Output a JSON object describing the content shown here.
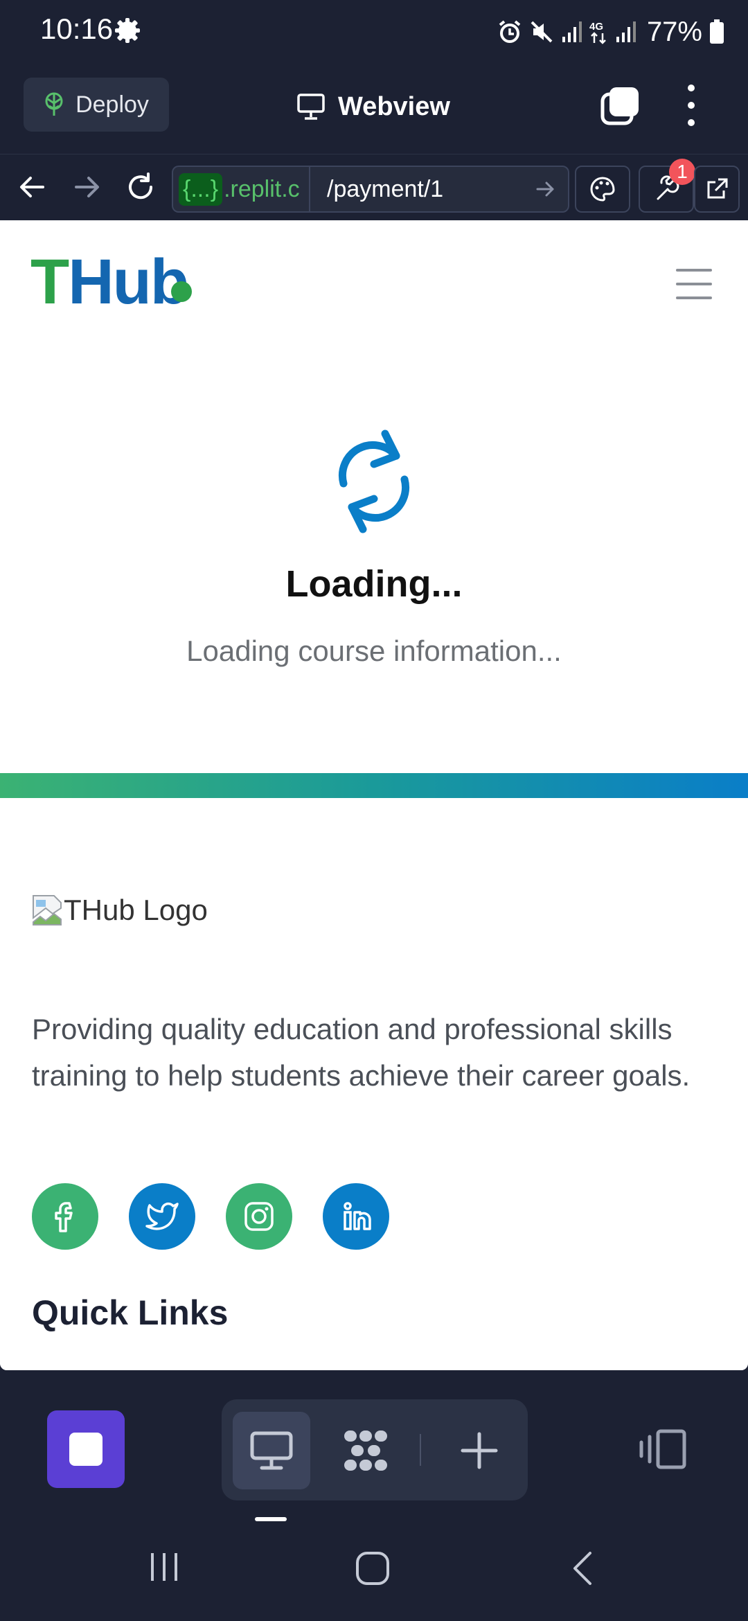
{
  "status_bar": {
    "time": "10:16",
    "battery": "77%",
    "network": "4G",
    "icons": [
      "settings-gear-icon",
      "alarm-icon",
      "mute-icon",
      "signal-icon",
      "4g-icon",
      "signal-icon",
      "battery-icon"
    ]
  },
  "replit_toolbar": {
    "deploy_label": "Deploy",
    "title": "Webview"
  },
  "url_bar": {
    "host_tag": "{...}",
    "host_suffix": ".replit.c",
    "path": "/payment/1",
    "notification_count": "1"
  },
  "site": {
    "logo": {
      "t": "T",
      "hu": "Hu",
      "b": "b"
    },
    "loading": {
      "title": "Loading...",
      "subtitle": "Loading course information..."
    },
    "footer": {
      "logo_alt": "THub Logo",
      "description": "Providing quality education and professional skills training to help students achieve their career goals.",
      "social": [
        "facebook",
        "twitter",
        "instagram",
        "linkedin"
      ],
      "quick_links_heading": "Quick Links"
    }
  },
  "colors": {
    "background_dark": "#1c2133",
    "brand_green": "#2da14a",
    "brand_blue": "#1466b0",
    "stop_purple": "#5b3fd4",
    "badge_red": "#f2545b"
  }
}
